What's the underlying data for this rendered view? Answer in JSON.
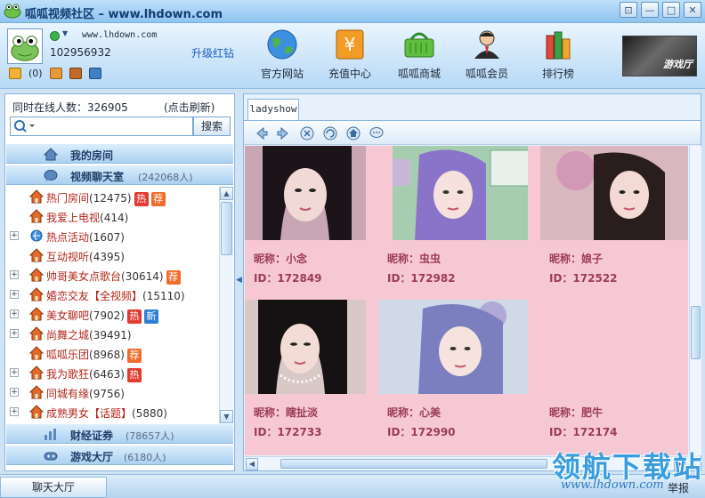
{
  "window": {
    "title": "呱呱视频社区 – www.lhdown.com",
    "buttons": [
      "⊡",
      "—",
      "□",
      "✕"
    ]
  },
  "user": {
    "site": "www.lhdown.com",
    "id": "102956932",
    "upgrade": "升级红钻",
    "mail_count": "(0)"
  },
  "nav": [
    {
      "label": "官方网站",
      "icon": "globe-icon"
    },
    {
      "label": "充值中心",
      "icon": "yuan-icon"
    },
    {
      "label": "呱呱商城",
      "icon": "basket-icon"
    },
    {
      "label": "呱呱会员",
      "icon": "member-icon"
    },
    {
      "label": "排行榜",
      "icon": "books-icon"
    }
  ],
  "ad": {
    "text": "游戏厅"
  },
  "left": {
    "online_label": "同时在线人数：326905",
    "refresh": "(点击刷新)",
    "search_placeholder": "",
    "search_button": "搜索",
    "my_room": "我的房间",
    "video_chat": "视频聊天室",
    "video_chat_count": "(242068人)",
    "finance": "财经证券",
    "finance_count": "(78657人)",
    "games": "游戏大厅",
    "games_count": "(6180人)",
    "rooms": [
      {
        "name": "热门房间",
        "count": "(12475)",
        "tags": [
          "热",
          "荐"
        ],
        "expand": false,
        "icon": "house-icon"
      },
      {
        "name": "我爱上电视",
        "count": "(414)",
        "tags": [],
        "expand": false,
        "icon": "house-icon"
      },
      {
        "name": "热点活动",
        "count": "(1607)",
        "tags": [],
        "expand": true,
        "icon": "ie-icon"
      },
      {
        "name": "互动视听",
        "count": "(4395)",
        "tags": [],
        "expand": false,
        "icon": "house-icon"
      },
      {
        "name": "帅哥美女点歌台",
        "count": "(30614)",
        "tags": [
          "荐"
        ],
        "expand": true,
        "icon": "house-icon"
      },
      {
        "name": "婚恋交友【全视频】",
        "count": "(15110)",
        "tags": [],
        "expand": true,
        "icon": "house-icon"
      },
      {
        "name": "美女聊吧",
        "count": "(7902)",
        "tags": [
          "热",
          "新"
        ],
        "expand": true,
        "icon": "house-icon"
      },
      {
        "name": "尚舞之城",
        "count": "(39491)",
        "tags": [],
        "expand": true,
        "icon": "house-icon"
      },
      {
        "name": "呱呱乐团",
        "count": "(8968)",
        "tags": [
          "荐"
        ],
        "expand": false,
        "icon": "house-icon"
      },
      {
        "name": "我为歌狂",
        "count": "(6463)",
        "tags": [
          "热"
        ],
        "expand": true,
        "icon": "house-icon"
      },
      {
        "name": "同城有缘",
        "count": "(9756)",
        "tags": [],
        "expand": true,
        "icon": "house-icon"
      },
      {
        "name": "成熟男女【话题】",
        "count": "(5880)",
        "tags": [],
        "expand": true,
        "icon": "house-icon"
      }
    ]
  },
  "right": {
    "tab": "ladyshow",
    "nick_prefix": "昵称：",
    "cards": [
      {
        "nick": "昵称：小念",
        "id": "ID：172849",
        "hair": "#1c1418",
        "bg": "#c9a6b4"
      },
      {
        "nick": "昵称：虫虫",
        "id": "ID：172982",
        "hair": "#8a74c9",
        "bg": "#a6cdb0"
      },
      {
        "nick": "昵称：娘子",
        "id": "ID：172522",
        "hair": "#2a1d1d",
        "bg": "#d9b7bf"
      },
      {
        "nick": "昵称：瞎扯淡",
        "id": "ID：172733",
        "hair": "#161214",
        "bg": "#d8c9c6"
      },
      {
        "nick": "昵称：心美",
        "id": "ID：172990",
        "hair": "#7b7fc0",
        "bg": "#cfd9e8"
      },
      {
        "nick": "昵称：肥牛",
        "id": "ID：172174",
        "hair": "",
        "bg": ""
      }
    ]
  },
  "bottom": {
    "hall_tab": "聊天大厅",
    "report": "举报"
  },
  "watermark": {
    "big": "领航下载站",
    "small": "www.lhdown.com"
  }
}
